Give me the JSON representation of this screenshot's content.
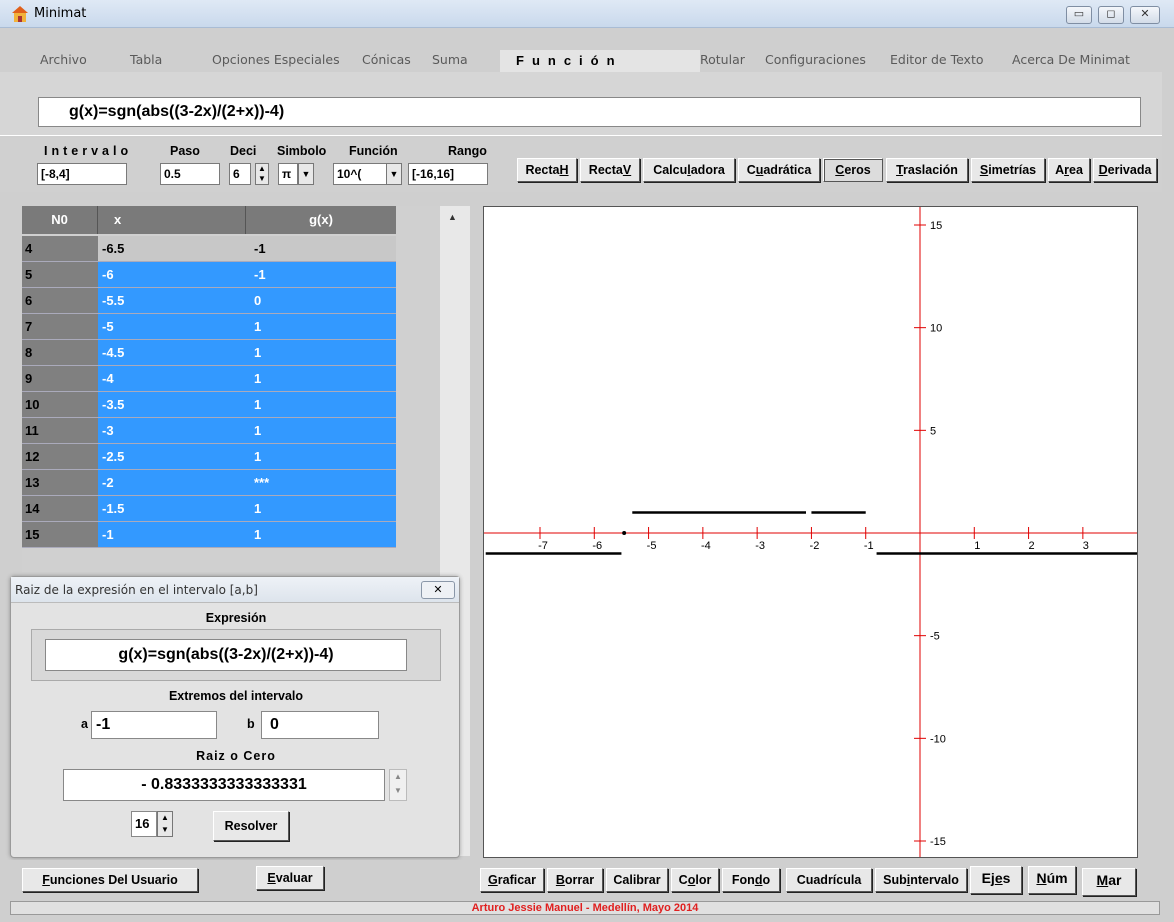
{
  "window": {
    "title": "Minimat"
  },
  "menu": {
    "left": [
      "Archivo",
      "Tabla",
      "Opciones Especiales",
      "Cónicas",
      "Suma"
    ],
    "right": [
      "Rotular",
      "Configuraciones",
      "Editor de Texto",
      "Acerca De Minimat"
    ]
  },
  "function": {
    "heading": "Función",
    "expression": "g(x)=sgn(abs((3-2x)/(2+x))-4)"
  },
  "controls": {
    "intervalo_label": "Intervalo",
    "intervalo": "[-8,4]",
    "paso_label": "Paso",
    "paso": "0.5",
    "deci_label": "Deci",
    "deci": "6",
    "simbolo_label": "Simbolo",
    "simbolo": "π",
    "funcion_label": "Función",
    "funcion": "10^(",
    "rango_label": "Rango",
    "rango": "[-16,16]"
  },
  "tool_buttons": [
    "RectaH",
    "RectaV",
    "Calculadora",
    "Cuadrática",
    "Ceros",
    "Traslación",
    "Simetrías",
    "Area",
    "Derivada"
  ],
  "table": {
    "headers": [
      "N0",
      "x",
      "g(x)"
    ],
    "rows": [
      {
        "n": "4",
        "x": "-6.5",
        "g": "-1",
        "selected": false
      },
      {
        "n": "5",
        "x": "-6",
        "g": "-1",
        "selected": true
      },
      {
        "n": "6",
        "x": "-5.5",
        "g": "0",
        "selected": true
      },
      {
        "n": "7",
        "x": "-5",
        "g": "1",
        "selected": true
      },
      {
        "n": "8",
        "x": "-4.5",
        "g": "1",
        "selected": true
      },
      {
        "n": "9",
        "x": "-4",
        "g": "1",
        "selected": true
      },
      {
        "n": "10",
        "x": "-3.5",
        "g": "1",
        "selected": true
      },
      {
        "n": "11",
        "x": "-3",
        "g": "1",
        "selected": true
      },
      {
        "n": "12",
        "x": "-2.5",
        "g": "1",
        "selected": true
      },
      {
        "n": "13",
        "x": "-2",
        "g": "***",
        "selected": true
      },
      {
        "n": "14",
        "x": "-1.5",
        "g": "1",
        "selected": true
      },
      {
        "n": "15",
        "x": "-1",
        "g": "1",
        "selected": true
      }
    ]
  },
  "dialog": {
    "title": "Raiz de la expresión en el intervalo [a,b]",
    "expr_label": "Expresión",
    "expr": "g(x)=sgn(abs((3-2x)/(2+x))-4)",
    "extremos_label": "Extremos del intervalo",
    "a_label": "a",
    "a_value": "-1",
    "b_label": "b",
    "b_value": "0",
    "raiz_label": "Raiz o Cero",
    "raiz_value": "- 0.8333333333333331",
    "precision": "16",
    "resolver": "Resolver"
  },
  "graph": {
    "x_ticks": [
      -7,
      -6,
      -5,
      -4,
      -3,
      -2,
      -1,
      1,
      2,
      3
    ],
    "y_ticks": [
      15,
      10,
      5,
      -5,
      -10,
      -15
    ],
    "xlim": [
      -8,
      4
    ],
    "ylim": [
      -16,
      16
    ],
    "segments": [
      {
        "x1": -8,
        "x2": -5.5,
        "y": -1
      },
      {
        "x1": -5.3,
        "x2": -2.1,
        "y": 1
      },
      {
        "x1": -2.0,
        "x2": -1.0,
        "y": 1
      },
      {
        "x1": -0.8,
        "x2": 4,
        "y": -1
      }
    ],
    "dot": {
      "x": -5.45,
      "y": 0
    },
    "axis_color": "#e00000",
    "curve_color": "#000000"
  },
  "left_bottom_buttons": [
    "Funciones Del Usuario",
    "Evaluar"
  ],
  "bottom_buttons": [
    "Graficar",
    "Borrar",
    "Calibrar",
    "Color",
    "Fondo",
    "Cuadrícula",
    "Subintervalo",
    "Ejes",
    "Núm",
    "Mar"
  ],
  "status": "Arturo Jessie Manuel - Medellín, Mayo 2014"
}
